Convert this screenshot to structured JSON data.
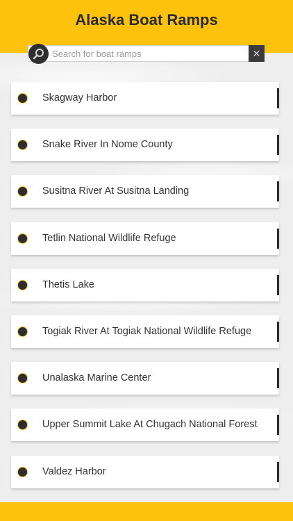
{
  "app": {
    "title": "Alaska Boat Ramps"
  },
  "search": {
    "placeholder": "Search for boat ramps",
    "value": "",
    "clear_symbol": "✕"
  },
  "icons": {
    "search": "search-icon",
    "clear": "close-icon",
    "bullet": "circle-bullet-icon"
  },
  "colors": {
    "accent": "#fcc20c",
    "dark": "#2d2d2d"
  },
  "ramps": [
    {
      "label": "Skagway Harbor"
    },
    {
      "label": "Snake River In Nome County"
    },
    {
      "label": "Susitna River At Susitna Landing"
    },
    {
      "label": "Tetlin National Wildlife Refuge"
    },
    {
      "label": "Thetis Lake"
    },
    {
      "label": "Togiak River At Togiak National Wildlife Refuge"
    },
    {
      "label": "Unalaska Marine Center"
    },
    {
      "label": "Upper Summit Lake At Chugach National Forest"
    },
    {
      "label": "Valdez Harbor"
    }
  ]
}
